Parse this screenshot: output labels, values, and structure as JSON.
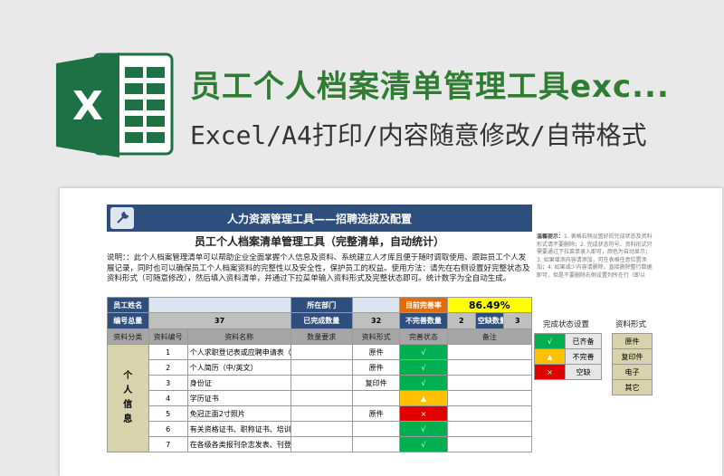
{
  "header": {
    "title": "员工个人档案清单管理工具exc...",
    "subtitle": "Excel/A4打印/内容随意修改/自带格式"
  },
  "sheet": {
    "banner": "人力资源管理工具——招聘选拔及配置",
    "title": "员工个人档案清单管理工具（完整清单，自动统计）",
    "description": "说明：：此个人档案管理清单可以帮助企业全面掌握个人信息及资料、系统建立人才库且便于随时调取使用、跟踪员工个人发展记录，同时也可以确保员工个人档案资料的完整性以及安全性，保护员工的权益。使用方法：请先在右侧设置好完整状态及资料形式（可随意修改），然后填入资料清单，并通过下拉菜单输入资料形式及完整状态即可。统计数字为全自动生成。",
    "row1": {
      "name_label": "员工姓名",
      "name_value": "",
      "dept_label": "所在部门",
      "dept_value": "",
      "rate_label": "目前完善率",
      "rate_value": "86.49%"
    },
    "row2": {
      "total_label": "编号总量",
      "total_value": "37",
      "done_label": "已完成数量",
      "done_value": "32",
      "incomplete_label": "不完善数量",
      "incomplete_value": "2",
      "missing_label": "空缺数量",
      "missing_value": "3"
    },
    "columns": [
      "资料分类",
      "资料编号",
      "资料名称",
      "数量要求",
      "资料形式",
      "完善状态",
      "备注"
    ],
    "category": "个人信息",
    "rows": [
      {
        "no": "1",
        "name": "个人求职登记表或应聘申请表（附照片）",
        "form": "原件",
        "status": "√",
        "level": "g"
      },
      {
        "no": "2",
        "name": "个人简历（中/英文）",
        "form": "原件",
        "status": "√",
        "level": "g"
      },
      {
        "no": "3",
        "name": "身份证",
        "form": "复印件",
        "status": "√",
        "level": "g"
      },
      {
        "no": "4",
        "name": "学历证书",
        "form": "",
        "status": "▲",
        "level": "y"
      },
      {
        "no": "5",
        "name": "免冠正面2寸照片",
        "form": "原件",
        "status": "×",
        "level": "r"
      },
      {
        "no": "6",
        "name": "有关资格证书、职称证书、培训证书",
        "form": "",
        "status": "√",
        "level": "g"
      },
      {
        "no": "7",
        "name": "在各级各类报刊杂志发表、刊登文章",
        "form": "",
        "status": "√",
        "level": "g"
      }
    ]
  },
  "tips": {
    "label": "温馨提示：",
    "text": "1. 表格右侧设置好的完成状态及资料形式请不要删除；2. 完成状态符号、资料形式只需要通过下拉菜单录入即可，颜色为自动显示；3. 如果增添内容请添加，可在表格任意位置添加；4. 如果减少内容请删除，直接删除整行数据即可，但是不要删除右侧设置列所在行（即以"
  },
  "status_legend": {
    "title": "完成状态设置",
    "items": [
      {
        "symbol": "√",
        "label": "已齐备",
        "level": "g"
      },
      {
        "symbol": "▲",
        "label": "不完善",
        "level": "y"
      },
      {
        "symbol": "×",
        "label": "空缺",
        "level": "r"
      }
    ]
  },
  "form_legend": {
    "title": "资料形式",
    "items": [
      "原件",
      "复印件",
      "电子",
      "其它"
    ]
  },
  "colors": {
    "brand_green": "#2e7d32",
    "banner_blue": "#2e4f7e",
    "ok": "#00b050",
    "warn": "#ffc000",
    "missing": "#e00000"
  }
}
